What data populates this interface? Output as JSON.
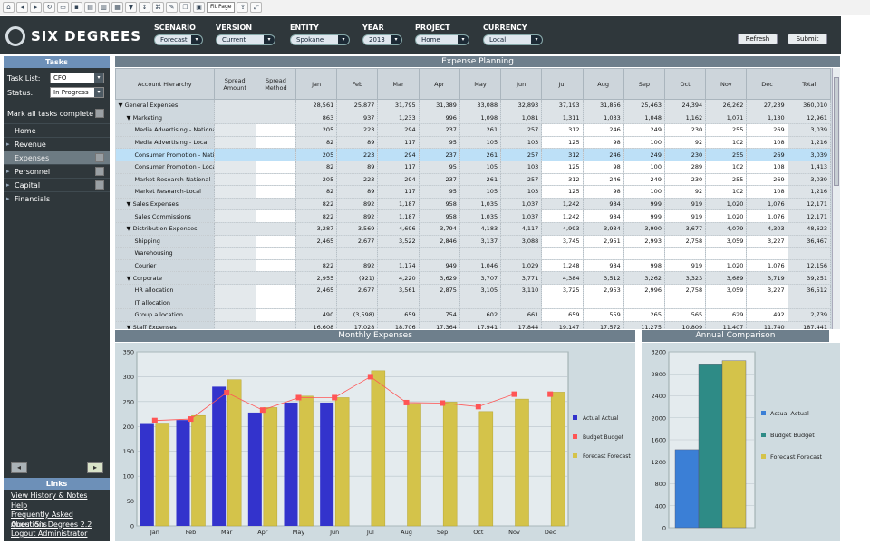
{
  "toolbar": {
    "zoom_value": "Fit Page"
  },
  "app": {
    "brand": "SIX DEGREES"
  },
  "filters": [
    {
      "label": "SCENARIO",
      "value": "Forecast"
    },
    {
      "label": "VERSION",
      "value": "Current"
    },
    {
      "label": "ENTITY",
      "value": "Spokane"
    },
    {
      "label": "YEAR",
      "value": "2013"
    },
    {
      "label": "PROJECT",
      "value": "Home"
    },
    {
      "label": "CURRENCY",
      "value": "Local"
    }
  ],
  "header_buttons": {
    "refresh": "Refresh",
    "submit": "Submit"
  },
  "sidebar": {
    "tasks_title": "Tasks",
    "task_list_label": "Task List:",
    "task_list_value": "CFO",
    "status_label": "Status:",
    "status_value": "In Progress",
    "mark_all": "Mark all tasks complete",
    "nav": [
      "Home",
      "Revenue",
      "Expenses",
      "Personnel",
      "Capital",
      "Financials"
    ],
    "links_title": "Links",
    "links": [
      "View History & Notes",
      "Help",
      "Frequently Asked Questions",
      "About Six Degrees 2.2",
      "Logout Administrator"
    ]
  },
  "grid": {
    "title": "Expense Planning",
    "headers": [
      "Account Hierarchy",
      "Spread Amount",
      "Spread Method",
      "Jan",
      "Feb",
      "Mar",
      "Apr",
      "May",
      "Jun",
      "Jul",
      "Aug",
      "Sep",
      "Oct",
      "Nov",
      "Dec",
      "Total"
    ],
    "rows": [
      {
        "name": "▼ General Expenses",
        "level": 0,
        "vals": [
          "28,561",
          "25,877",
          "31,795",
          "31,389",
          "33,088",
          "32,893",
          "37,193",
          "31,856",
          "25,463",
          "24,394",
          "26,262",
          "27,239",
          "360,010"
        ]
      },
      {
        "name": "▼ Marketing",
        "level": 1,
        "vals": [
          "863",
          "937",
          "1,233",
          "996",
          "1,098",
          "1,081",
          "1,311",
          "1,033",
          "1,048",
          "1,162",
          "1,071",
          "1,130",
          "12,961"
        ]
      },
      {
        "name": "Media Advertising - National",
        "level": 2,
        "vals": [
          "205",
          "223",
          "294",
          "237",
          "261",
          "257",
          "312",
          "246",
          "249",
          "230",
          "255",
          "269",
          "3,039"
        ]
      },
      {
        "name": "Media Advertising - Local",
        "level": 2,
        "vals": [
          "82",
          "89",
          "117",
          "95",
          "105",
          "103",
          "125",
          "98",
          "100",
          "92",
          "102",
          "108",
          "1,216"
        ]
      },
      {
        "name": "Consumer Promotion - National",
        "level": 2,
        "hl": true,
        "vals": [
          "205",
          "223",
          "294",
          "237",
          "261",
          "257",
          "312",
          "246",
          "249",
          "230",
          "255",
          "269",
          "3,039"
        ]
      },
      {
        "name": "Consumer Promotion - Local",
        "level": 2,
        "vals": [
          "82",
          "89",
          "117",
          "95",
          "105",
          "103",
          "125",
          "98",
          "100",
          "289",
          "102",
          "108",
          "1,413"
        ]
      },
      {
        "name": "Market Research-National",
        "level": 2,
        "vals": [
          "205",
          "223",
          "294",
          "237",
          "261",
          "257",
          "312",
          "246",
          "249",
          "230",
          "255",
          "269",
          "3,039"
        ]
      },
      {
        "name": "Market Research-Local",
        "level": 2,
        "vals": [
          "82",
          "89",
          "117",
          "95",
          "105",
          "103",
          "125",
          "98",
          "100",
          "92",
          "102",
          "108",
          "1,216"
        ]
      },
      {
        "name": "▼ Sales Expenses",
        "level": 1,
        "vals": [
          "822",
          "892",
          "1,187",
          "958",
          "1,035",
          "1,037",
          "1,242",
          "984",
          "999",
          "919",
          "1,020",
          "1,076",
          "12,171"
        ]
      },
      {
        "name": "Sales Commissions",
        "level": 2,
        "vals": [
          "822",
          "892",
          "1,187",
          "958",
          "1,035",
          "1,037",
          "1,242",
          "984",
          "999",
          "919",
          "1,020",
          "1,076",
          "12,171"
        ]
      },
      {
        "name": "▼ Distribution Expenses",
        "level": 1,
        "vals": [
          "3,287",
          "3,569",
          "4,696",
          "3,794",
          "4,183",
          "4,117",
          "4,993",
          "3,934",
          "3,990",
          "3,677",
          "4,079",
          "4,303",
          "48,623"
        ]
      },
      {
        "name": "Shipping",
        "level": 2,
        "vals": [
          "2,465",
          "2,677",
          "3,522",
          "2,846",
          "3,137",
          "3,088",
          "3,745",
          "2,951",
          "2,993",
          "2,758",
          "3,059",
          "3,227",
          "36,467"
        ]
      },
      {
        "name": "Warehousing",
        "level": 2,
        "vals": [
          "",
          "",
          "",
          "",
          "",
          "",
          "",
          "",
          "",
          "",
          "",
          "",
          ""
        ]
      },
      {
        "name": "Courier",
        "level": 2,
        "vals": [
          "822",
          "892",
          "1,174",
          "949",
          "1,046",
          "1,029",
          "1,248",
          "984",
          "998",
          "919",
          "1,020",
          "1,076",
          "12,156"
        ]
      },
      {
        "name": "▼ Corporate",
        "level": 1,
        "vals": [
          "2,955",
          "(921)",
          "4,220",
          "3,629",
          "3,707",
          "3,771",
          "4,384",
          "3,512",
          "3,262",
          "3,323",
          "3,689",
          "3,719",
          "39,251"
        ]
      },
      {
        "name": "HR allocation",
        "level": 2,
        "vals": [
          "2,465",
          "2,677",
          "3,561",
          "2,875",
          "3,105",
          "3,110",
          "3,725",
          "2,953",
          "2,996",
          "2,758",
          "3,059",
          "3,227",
          "36,512"
        ]
      },
      {
        "name": "IT allocation",
        "level": 2,
        "vals": [
          "",
          "",
          "",
          "",
          "",
          "",
          "",
          "",
          "",
          "",
          "",
          "",
          ""
        ]
      },
      {
        "name": "Group allocation",
        "level": 2,
        "vals": [
          "490",
          "(3,598)",
          "659",
          "754",
          "602",
          "661",
          "659",
          "559",
          "265",
          "565",
          "629",
          "492",
          "2,739"
        ]
      },
      {
        "name": "▼ Staff Expenses",
        "level": 1,
        "vals": [
          "16,608",
          "17,028",
          "18,706",
          "17,364",
          "17,941",
          "17,844",
          "19,147",
          "17,572",
          "11,275",
          "10,809",
          "11,407",
          "11,740",
          "187,441"
        ]
      }
    ]
  },
  "monthly_title": "Monthly Expenses",
  "annual_title": "Annual Comparison",
  "chart_data": [
    {
      "type": "bar",
      "categories": [
        "Jan",
        "Feb",
        "Mar",
        "Apr",
        "May",
        "Jun",
        "Jul",
        "Aug",
        "Sep",
        "Oct",
        "Nov",
        "Dec"
      ],
      "ylim": [
        0,
        350
      ],
      "yticks": [
        0,
        50,
        100,
        150,
        200,
        250,
        300,
        350
      ],
      "series": [
        {
          "name": "Actual Actual",
          "kind": "bar",
          "color": "#3333cc",
          "values": [
            205,
            213,
            280,
            228,
            248,
            248,
            null,
            null,
            null,
            null,
            null,
            null
          ]
        },
        {
          "name": "Budget Budget",
          "kind": "line",
          "color": "#ff5555",
          "values": [
            212,
            215,
            268,
            233,
            258,
            258,
            300,
            248,
            247,
            240,
            265,
            265
          ]
        },
        {
          "name": "Forecast Forecast",
          "kind": "bar",
          "color": "#d4c34a",
          "values": [
            205,
            222,
            294,
            238,
            261,
            258,
            312,
            246,
            249,
            230,
            255,
            269
          ]
        }
      ],
      "legend": "right"
    },
    {
      "type": "bar",
      "ylim": [
        0,
        3200
      ],
      "yticks": [
        0,
        400,
        800,
        1200,
        1600,
        2000,
        2400,
        2800,
        3200
      ],
      "series": [
        {
          "name": "Actual Actual",
          "color": "#3b7fd6",
          "values": [
            1420
          ]
        },
        {
          "name": "Budget Budget",
          "color": "#2e8b86",
          "values": [
            2980
          ]
        },
        {
          "name": "Forecast Forecast",
          "color": "#d4c34a",
          "values": [
            3039
          ]
        }
      ],
      "legend": "right"
    }
  ]
}
